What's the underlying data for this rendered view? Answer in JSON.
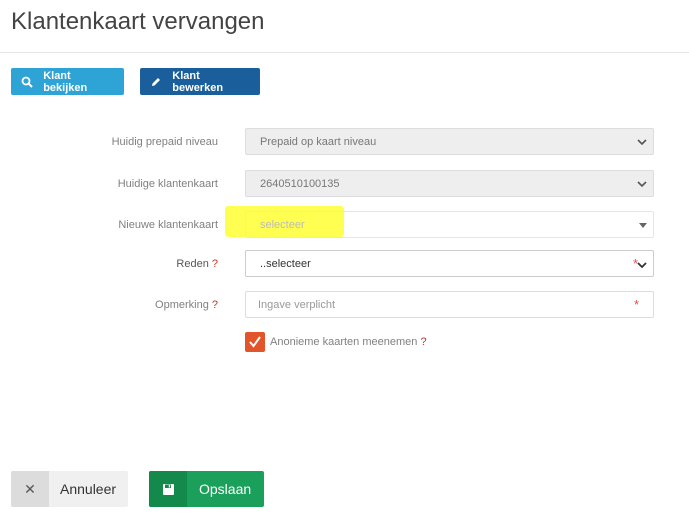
{
  "page": {
    "title": "Klantenkaart vervangen"
  },
  "toolbar": {
    "view_label": "Klant bekijken",
    "edit_label": "Klant bewerken"
  },
  "form": {
    "prepaid_level": {
      "label": "Huidig prepaid niveau",
      "value": "Prepaid op kaart niveau"
    },
    "current_card": {
      "label": "Huidige klantenkaart",
      "value": "2640510100135"
    },
    "new_card": {
      "label": "Nieuwe klantenkaart",
      "value": "selecteer"
    },
    "reason": {
      "label": "Reden",
      "help": "?",
      "value": "..selecteer",
      "required_mark": "*"
    },
    "remark": {
      "label": "Opmerking",
      "help": "?",
      "placeholder": "Ingave verplicht",
      "required_mark": "*"
    },
    "anonymous_cards": {
      "label": "Anonieme kaarten meenemen",
      "help": "?",
      "checked": true
    }
  },
  "footer": {
    "cancel_label": "Annuleer",
    "save_label": "Opslaan"
  },
  "colors": {
    "view_button": "#2ea3d6",
    "edit_button": "#1a5f9b",
    "checkbox": "#e2552a",
    "save_button": "#1aa05a",
    "required": "#d9534f",
    "highlight": "#ffff33"
  }
}
